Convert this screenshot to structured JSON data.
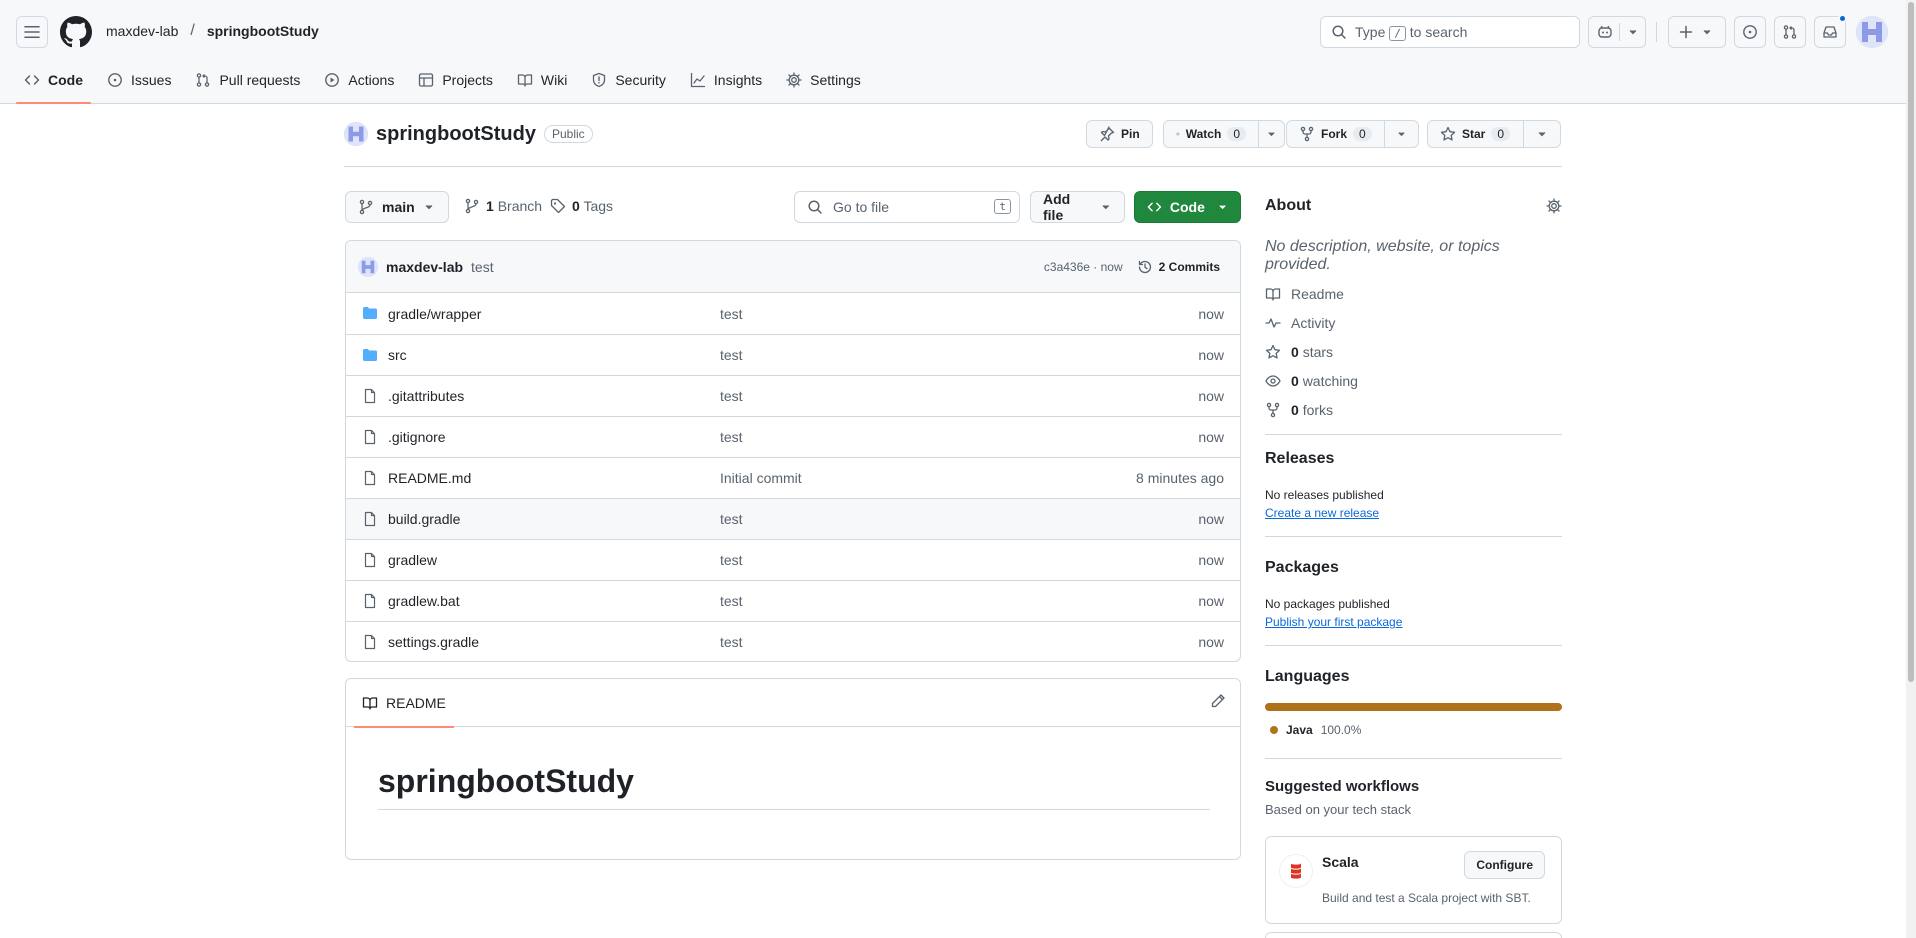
{
  "header": {
    "owner": "maxdev-lab",
    "separator": "/",
    "repo": "springbootStudy",
    "search_prefix": "Type",
    "search_key": "/",
    "search_suffix": "to search"
  },
  "repo_nav": {
    "tabs": [
      {
        "label": "Code",
        "icon": "code-icon"
      },
      {
        "label": "Issues",
        "icon": "issue-icon"
      },
      {
        "label": "Pull requests",
        "icon": "pull-request-icon"
      },
      {
        "label": "Actions",
        "icon": "play-icon"
      },
      {
        "label": "Projects",
        "icon": "table-icon"
      },
      {
        "label": "Wiki",
        "icon": "book-icon"
      },
      {
        "label": "Security",
        "icon": "shield-icon"
      },
      {
        "label": "Insights",
        "icon": "graph-icon"
      },
      {
        "label": "Settings",
        "icon": "gear-icon"
      }
    ]
  },
  "repo_header": {
    "name": "springbootStudy",
    "visibility": "Public",
    "pin_label": "Pin",
    "watch_label": "Watch",
    "watch_count": "0",
    "fork_label": "Fork",
    "fork_count": "0",
    "star_label": "Star",
    "star_count": "0"
  },
  "file_nav": {
    "branch": "main",
    "branch_count": "1",
    "branch_label": "Branch",
    "tag_count": "0",
    "tag_label": "Tags",
    "goto_placeholder": "Go to file",
    "goto_key": "t",
    "add_file_label": "Add file",
    "code_label": "Code"
  },
  "latest_commit": {
    "author": "maxdev-lab",
    "message": "test",
    "hash_time": "c3a436e · now",
    "commits_label": "2 Commits"
  },
  "files": [
    {
      "name": "gradle/wrapper",
      "type": "folder",
      "message": "test",
      "date": "now"
    },
    {
      "name": "src",
      "type": "folder",
      "message": "test",
      "date": "now"
    },
    {
      "name": ".gitattributes",
      "type": "file",
      "message": "test",
      "date": "now"
    },
    {
      "name": ".gitignore",
      "type": "file",
      "message": "test",
      "date": "now"
    },
    {
      "name": "README.md",
      "type": "file",
      "message": "Initial commit",
      "date": "8 minutes ago"
    },
    {
      "name": "build.gradle",
      "type": "file",
      "message": "test",
      "date": "now"
    },
    {
      "name": "gradlew",
      "type": "file",
      "message": "test",
      "date": "now"
    },
    {
      "name": "gradlew.bat",
      "type": "file",
      "message": "test",
      "date": "now"
    },
    {
      "name": "settings.gradle",
      "type": "file",
      "message": "test",
      "date": "now"
    }
  ],
  "readme": {
    "tab_label": "README",
    "heading": "springbootStudy"
  },
  "about": {
    "title": "About",
    "description": "No description, website, or topics provided.",
    "readme_label": "Readme",
    "activity_label": "Activity",
    "stars_count": "0",
    "stars_label": "stars",
    "watching_count": "0",
    "watching_label": "watching",
    "forks_count": "0",
    "forks_label": "forks"
  },
  "releases": {
    "title": "Releases",
    "empty_text": "No releases published",
    "create_link": "Create a new release"
  },
  "packages": {
    "title": "Packages",
    "empty_text": "No packages published",
    "publish_link": "Publish your first package"
  },
  "languages": {
    "title": "Languages",
    "items": [
      {
        "name": "Java",
        "percent": "100.0%",
        "color": "#b07219"
      }
    ]
  },
  "workflows": {
    "title": "Suggested workflows",
    "subtitle": "Based on your tech stack",
    "items": [
      {
        "name": "Scala",
        "description": "Build and test a Scala project with SBT.",
        "button": "Configure"
      }
    ]
  },
  "colors": {
    "accent_green": "#1f883d",
    "link_blue": "#0969da",
    "tab_underline": "#fd8c73",
    "java": "#b07219"
  }
}
